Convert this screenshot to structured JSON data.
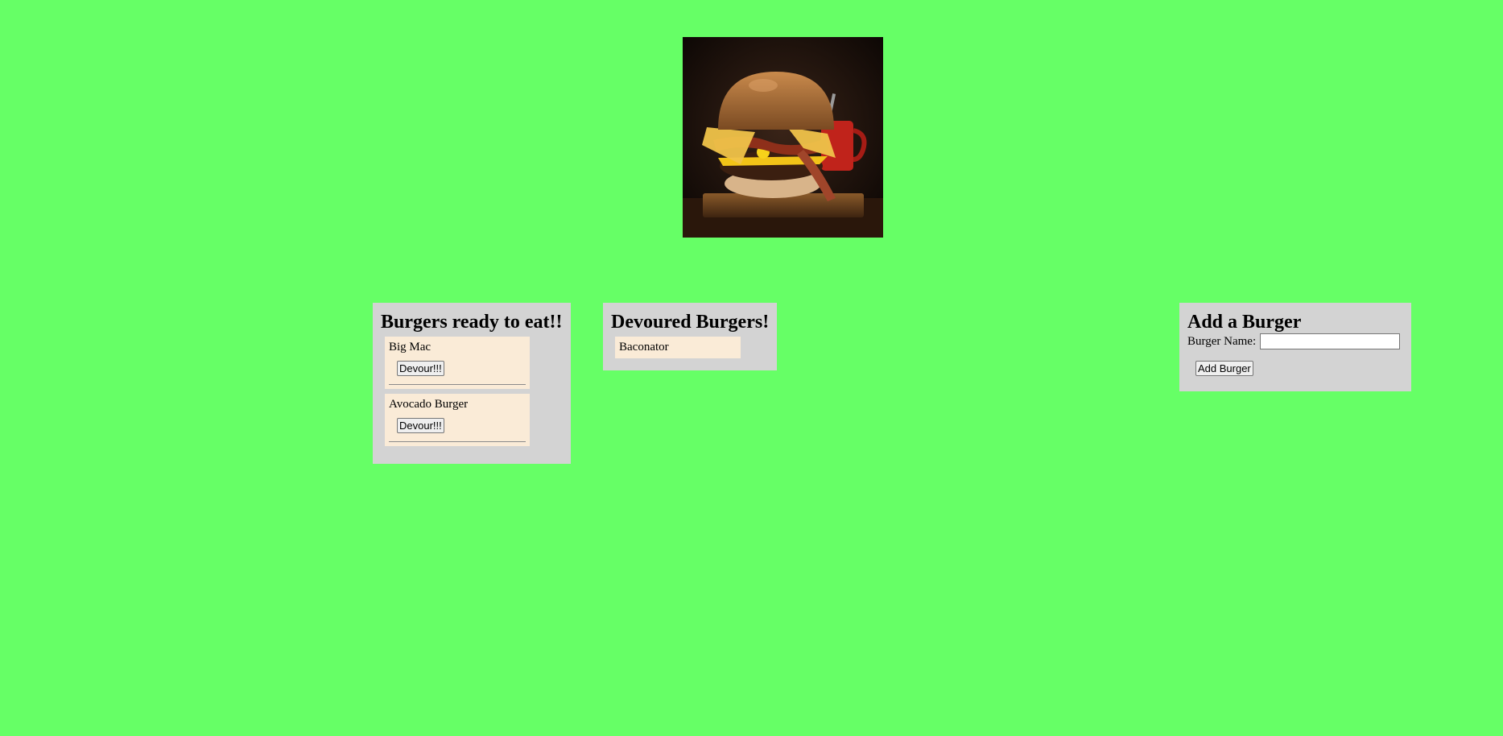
{
  "hero": {
    "image_name": "burger-photo"
  },
  "ready": {
    "title": "Burgers ready to eat!!",
    "items": [
      {
        "name": "Big Mac",
        "button_label": "Devour!!!"
      },
      {
        "name": "Avocado Burger",
        "button_label": "Devour!!!"
      }
    ]
  },
  "devoured": {
    "title": "Devoured Burgers!",
    "items": [
      {
        "name": "Baconator"
      }
    ]
  },
  "add_form": {
    "title": "Add a Burger",
    "label": "Burger Name:",
    "input_value": "",
    "button_label": "Add Burger"
  },
  "colors": {
    "page_background": "#66ff66",
    "panel_background": "#d3d3d3",
    "item_background": "#faebd7"
  }
}
